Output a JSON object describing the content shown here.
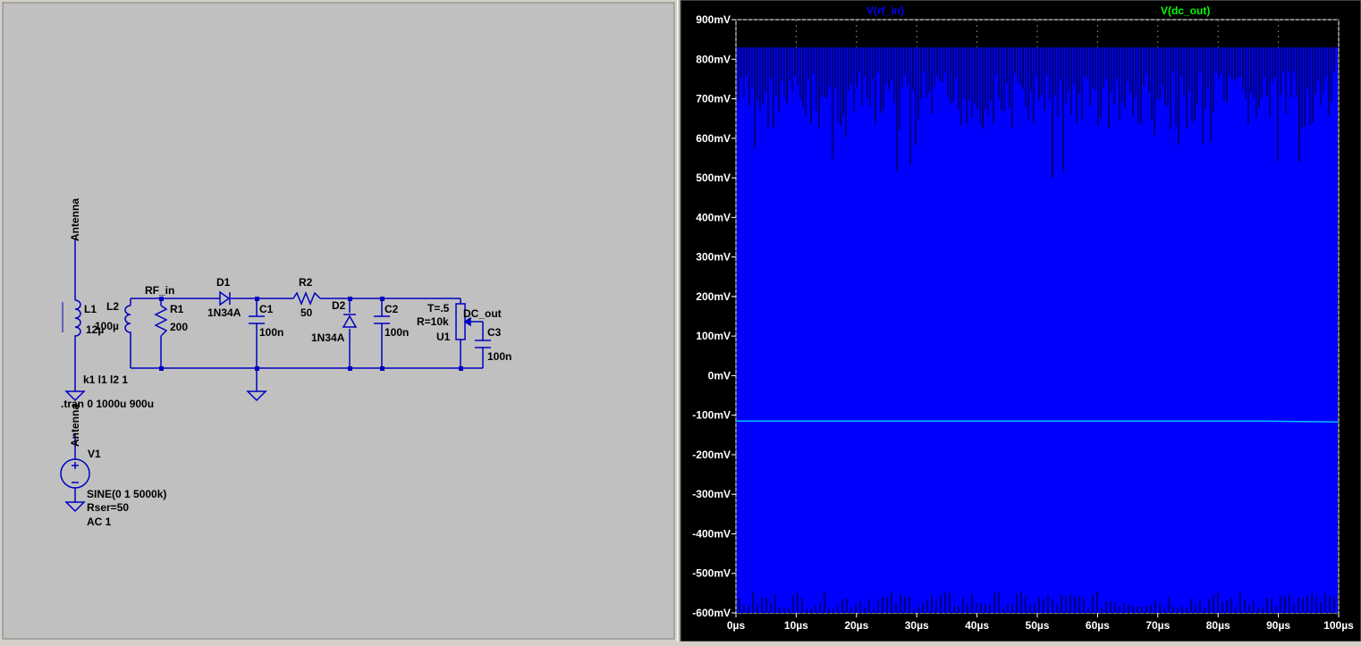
{
  "schematic": {
    "labels": {
      "antenna_top": "Antenna",
      "antenna_bottom": "Antenna",
      "l1_name": "L1",
      "l1_value": "12µ",
      "l2_name": "L2",
      "l2_value": "100µ",
      "net_rf_in": "RF_in",
      "r1_name": "R1",
      "r1_value": "200",
      "d1_name": "D1",
      "d1_value": "1N34A",
      "c1_name": "C1",
      "c1_value": "100n",
      "r2_name": "R2",
      "r2_value": "50",
      "d2_name": "D2",
      "d2_value": "1N34A",
      "c2_name": "C2",
      "c2_value": "100n",
      "u1_t": "T=.5",
      "u1_r": "R=10k",
      "u1_name": "U1",
      "net_dc_out": "DC_out",
      "c3_name": "C3",
      "c3_value": "100n",
      "coupling": "k1 l1 l2 1",
      "tran": ".tran 0 1000u 900u",
      "v1_name": "V1",
      "v1_value": "SINE(0 1 5000k)",
      "v1_rser": "Rser=50",
      "v1_ac": "AC 1"
    },
    "colors": {
      "background": "#c0c0c0",
      "wire": "#0000c0",
      "component": "#0000c0",
      "text": "#000000",
      "junction": "#0000c0"
    }
  },
  "waveform": {
    "traces": [
      {
        "name": "V(rf_in)",
        "color": "#0000ff"
      },
      {
        "name": "V(dc_out)",
        "color": "#00ff00"
      }
    ],
    "colors": {
      "background": "#000000",
      "axis_text": "#ffffff",
      "grid": "#808080",
      "fill": "#0000ff",
      "dc_line": "#00c0ff"
    }
  },
  "chart_data": {
    "type": "line",
    "xlabel": "",
    "ylabel": "",
    "xlim": [
      0,
      100
    ],
    "ylim": [
      -600,
      900
    ],
    "x_ticks": [
      "0µs",
      "10µs",
      "20µs",
      "30µs",
      "40µs",
      "50µs",
      "60µs",
      "70µs",
      "80µs",
      "90µs",
      "100µs"
    ],
    "y_ticks": [
      "900mV",
      "800mV",
      "700mV",
      "600mV",
      "500mV",
      "400mV",
      "300mV",
      "200mV",
      "100mV",
      "0mV",
      "-100mV",
      "-200mV",
      "-300mV",
      "-400mV",
      "-500mV",
      "-600mV"
    ],
    "series": [
      {
        "name": "V(rf_in)",
        "envelope_max_mV": 830,
        "envelope_min_mV": -600,
        "dip_max_mV": 470
      },
      {
        "name": "V(dc_out)",
        "x": [
          0,
          87,
          100
        ],
        "y": [
          -115,
          -115,
          -117
        ]
      }
    ]
  }
}
